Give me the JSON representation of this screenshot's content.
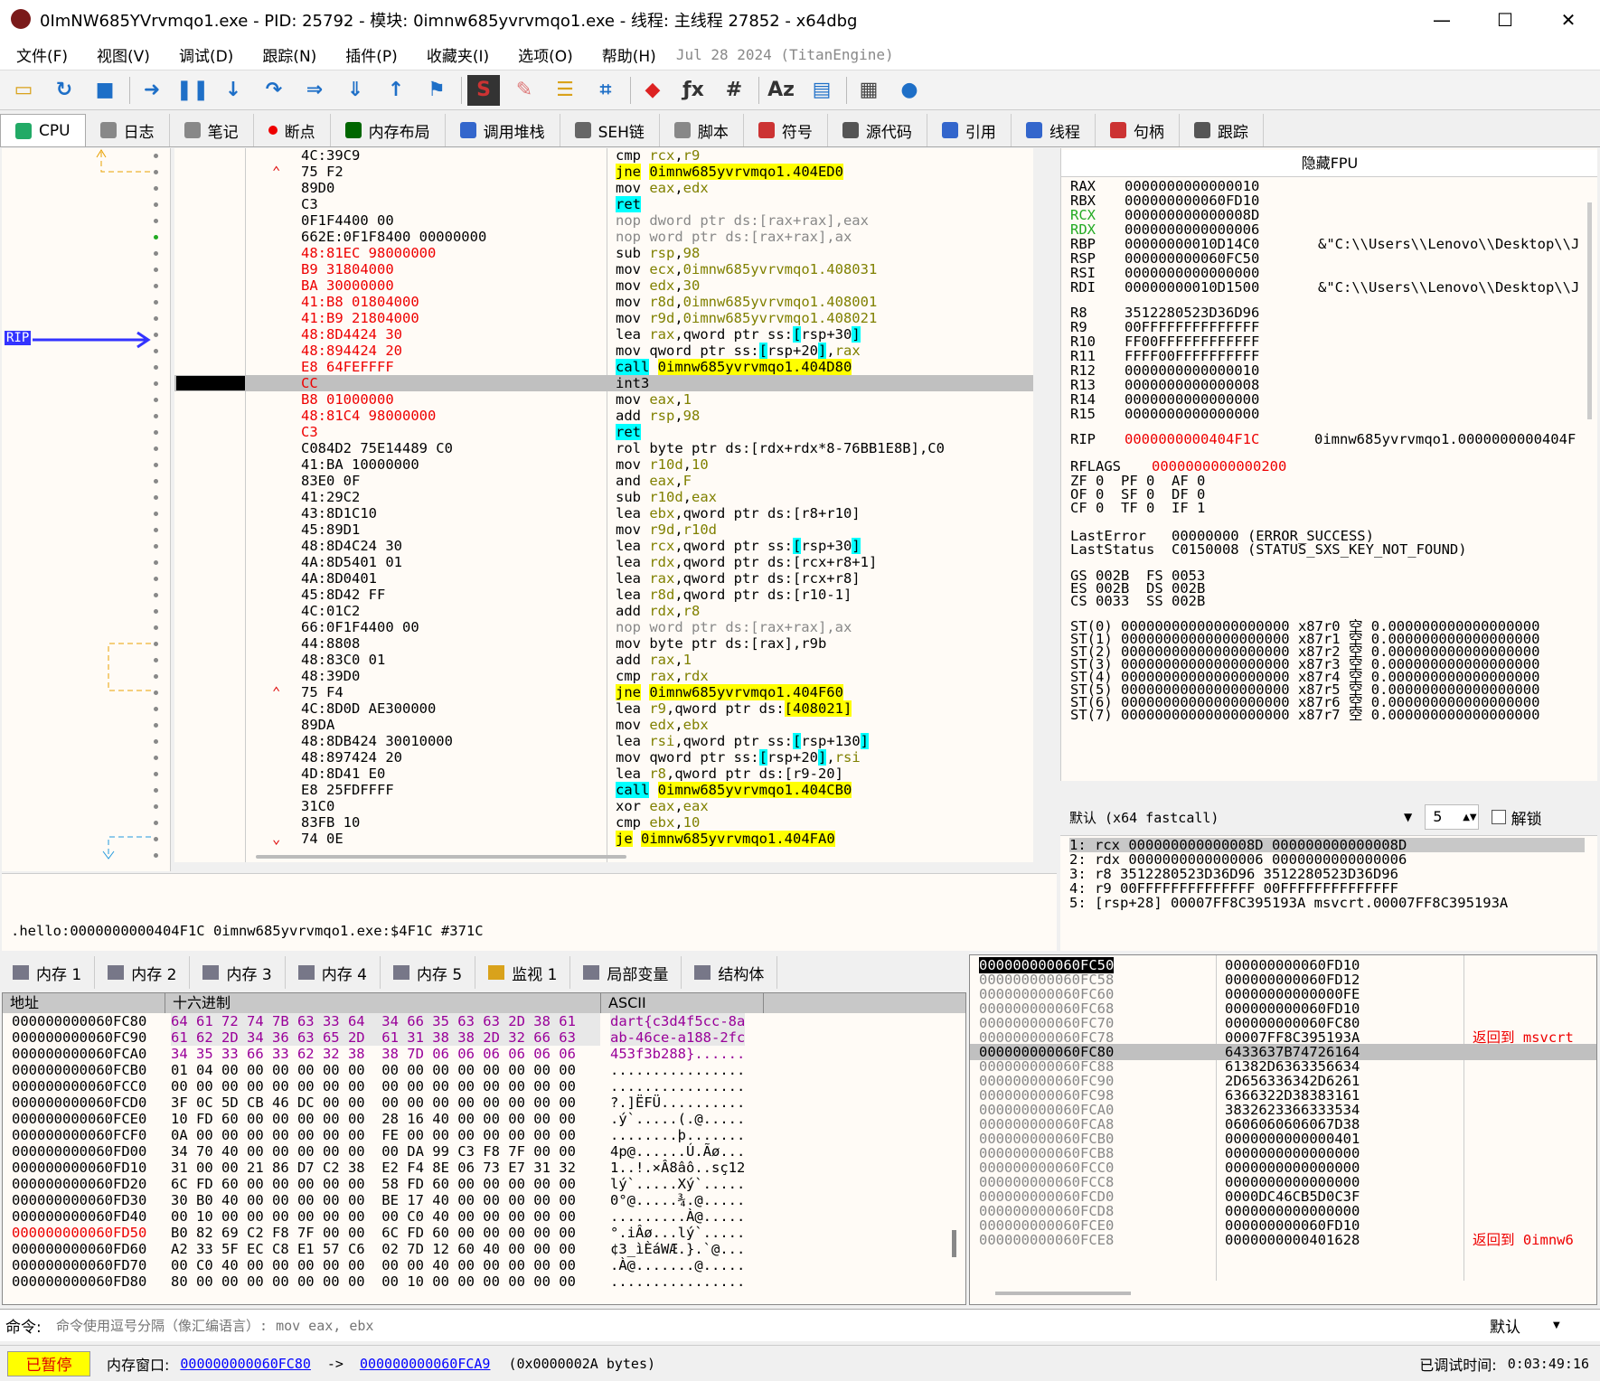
{
  "window": {
    "title": "0ImNW685YVrvmqo1.exe - PID: 25792 - 模块: 0imnw685yvrvmqo1.exe - 线程: 主线程 27852 - x64dbg",
    "minimize": "—",
    "maximize": "☐",
    "close": "✕"
  },
  "menu": [
    "文件(F)",
    "视图(V)",
    "调试(D)",
    "跟踪(N)",
    "插件(P)",
    "收藏夹(I)",
    "选项(O)",
    "帮助(H)"
  ],
  "menu_date": "Jul 28 2024 (TitanEngine)",
  "toolbar": [
    "open-icon",
    "restart-icon",
    "stop-icon",
    "run-icon",
    "pause-icon",
    "step-into-icon",
    "step-over-icon",
    "trace-into-icon",
    "trace-over-icon",
    "execute-till-return-icon",
    "run-to-user-code-icon",
    "script-icon",
    "patch-icon",
    "comment-icon",
    "label-icon",
    "bookmark-icon",
    "function-icon",
    "hash-icon",
    "font-icon",
    "memory-map-icon",
    "calculator-icon",
    "globe-icon"
  ],
  "tabs": [
    {
      "label": "CPU",
      "color": "#2a6"
    },
    {
      "label": "日志",
      "color": "#888"
    },
    {
      "label": "笔记",
      "color": "#888"
    },
    {
      "label": "断点",
      "color": "#e00"
    },
    {
      "label": "内存布局",
      "color": "#060"
    },
    {
      "label": "调用堆栈",
      "color": "#36c"
    },
    {
      "label": "SEH链",
      "color": "#666"
    },
    {
      "label": "脚本",
      "color": "#888"
    },
    {
      "label": "符号",
      "color": "#c33"
    },
    {
      "label": "源代码",
      "color": "#555"
    },
    {
      "label": "引用",
      "color": "#36c"
    },
    {
      "label": "线程",
      "color": "#36c"
    },
    {
      "label": "句柄",
      "color": "#c33"
    },
    {
      "label": "跟踪",
      "color": "#555"
    }
  ],
  "gutter": {
    "rip_label": "RIP"
  },
  "disasm": [
    {
      "b": "4C:39C9",
      "i": [
        [
          "cmp ",
          ""
        ],
        [
          "rcx",
          "reg"
        ],
        [
          ",",
          ""
        ],
        [
          "r9",
          "reg"
        ]
      ]
    },
    {
      "ar": "^",
      "b": "75 F2",
      "i": [
        [
          "jne",
          ""
        ],
        [
          " ",
          ""
        ],
        [
          "0imnw685yvrvmqo1.404ED0",
          "hl"
        ]
      ],
      "jhl": true
    },
    {
      "b": "89D0",
      "i": [
        [
          "mov ",
          ""
        ],
        [
          "eax",
          "reg"
        ],
        [
          ",",
          ""
        ],
        [
          "edx",
          "reg"
        ]
      ]
    },
    {
      "b": "C3",
      "i": [
        [
          "ret",
          "sq"
        ]
      ]
    },
    {
      "b": "0F1F4400 00",
      "i": [
        [
          "nop dword ptr ds:[rax+rax],eax",
          "gray"
        ]
      ]
    },
    {
      "b": "662E:0F1F8400 00000000",
      "i": [
        [
          "nop word ptr ds:[rax+rax],ax",
          "gray"
        ]
      ]
    },
    {
      "b": "48:81EC 98000000",
      "red": true,
      "i": [
        [
          "sub ",
          ""
        ],
        [
          "rsp",
          "reg"
        ],
        [
          ",",
          ""
        ],
        [
          "98",
          "num"
        ]
      ]
    },
    {
      "b": "B9 31804000",
      "red": true,
      "i": [
        [
          "mov ",
          ""
        ],
        [
          "ecx",
          "reg"
        ],
        [
          ",",
          ""
        ],
        [
          "0imnw685yvrvmqo1.408031",
          "num"
        ]
      ]
    },
    {
      "b": "BA 30000000",
      "red": true,
      "i": [
        [
          "mov ",
          ""
        ],
        [
          "edx",
          "reg"
        ],
        [
          ",",
          ""
        ],
        [
          "30",
          "num"
        ]
      ]
    },
    {
      "b": "41:B8 01804000",
      "red": true,
      "i": [
        [
          "mov ",
          ""
        ],
        [
          "r8d",
          "reg"
        ],
        [
          ",",
          ""
        ],
        [
          "0imnw685yvrvmqo1.408001",
          "num"
        ]
      ]
    },
    {
      "b": "41:B9 21804000",
      "red": true,
      "i": [
        [
          "mov ",
          ""
        ],
        [
          "r9d",
          "reg"
        ],
        [
          ",",
          ""
        ],
        [
          "0imnw685yvrvmqo1.408021",
          "num"
        ]
      ]
    },
    {
      "b": "48:8D4424 30",
      "red": true,
      "i": [
        [
          "lea ",
          ""
        ],
        [
          "rax",
          "reg"
        ],
        [
          ",qword ptr ",
          ""
        ],
        [
          "ss:",
          ""
        ],
        [
          "[",
          "sq"
        ],
        [
          "rsp+30",
          ""
        ],
        [
          "]",
          "sq"
        ]
      ]
    },
    {
      "b": "48:894424 20",
      "red": true,
      "i": [
        [
          "mov ",
          ""
        ],
        [
          "qword ptr ss:",
          ""
        ],
        [
          "[",
          "sq"
        ],
        [
          "rsp+20",
          ""
        ],
        [
          "]",
          "sq"
        ],
        [
          ",",
          ""
        ],
        [
          "rax",
          "reg"
        ]
      ]
    },
    {
      "b": "E8 64FEFFFF",
      "red": true,
      "i": [
        [
          "call",
          "sq"
        ],
        [
          " ",
          ""
        ],
        [
          "0imnw685yvrvmqo1.404D80",
          "hl"
        ]
      ]
    },
    {
      "b": "CC",
      "red": true,
      "sel": true,
      "i": [
        [
          "int3",
          ""
        ]
      ]
    },
    {
      "b": "B8 01000000",
      "red": true,
      "i": [
        [
          "mov ",
          ""
        ],
        [
          "eax",
          "reg"
        ],
        [
          ",",
          ""
        ],
        [
          "1",
          "num"
        ]
      ]
    },
    {
      "b": "48:81C4 98000000",
      "red": true,
      "i": [
        [
          "add ",
          ""
        ],
        [
          "rsp",
          "reg"
        ],
        [
          ",",
          ""
        ],
        [
          "98",
          "num"
        ]
      ]
    },
    {
      "b": "C3",
      "red": true,
      "i": [
        [
          "ret",
          "sq"
        ]
      ]
    },
    {
      "b": "C084D2 75E14489 C0",
      "i": [
        [
          "rol byte ptr ds:[rdx+rdx*8-76BB1E8B],C0",
          ""
        ]
      ]
    },
    {
      "b": "41:BA 10000000",
      "i": [
        [
          "mov ",
          ""
        ],
        [
          "r10d",
          "reg"
        ],
        [
          ",",
          ""
        ],
        [
          "10",
          "num"
        ]
      ]
    },
    {
      "b": "83E0 0F",
      "i": [
        [
          "and ",
          ""
        ],
        [
          "eax",
          "reg"
        ],
        [
          ",",
          ""
        ],
        [
          "F",
          "num"
        ]
      ]
    },
    {
      "b": "41:29C2",
      "i": [
        [
          "sub ",
          ""
        ],
        [
          "r10d",
          "reg"
        ],
        [
          ",",
          ""
        ],
        [
          "eax",
          "reg"
        ]
      ]
    },
    {
      "b": "43:8D1C10",
      "i": [
        [
          "lea ",
          ""
        ],
        [
          "ebx",
          "reg"
        ],
        [
          ",qword ptr ds:[r8+r10]",
          ""
        ]
      ]
    },
    {
      "b": "45:89D1",
      "i": [
        [
          "mov ",
          ""
        ],
        [
          "r9d",
          "reg"
        ],
        [
          ",",
          ""
        ],
        [
          "r10d",
          "reg"
        ]
      ]
    },
    {
      "b": "48:8D4C24 30",
      "i": [
        [
          "lea ",
          ""
        ],
        [
          "rcx",
          "reg"
        ],
        [
          ",qword ptr ss:",
          ""
        ],
        [
          "[",
          "sq"
        ],
        [
          "rsp+30",
          ""
        ],
        [
          "]",
          "sq"
        ]
      ]
    },
    {
      "b": "4A:8D5401 01",
      "i": [
        [
          "lea ",
          ""
        ],
        [
          "rdx",
          "reg"
        ],
        [
          ",qword ptr ds:[rcx+r8+1]",
          ""
        ]
      ]
    },
    {
      "b": "4A:8D0401",
      "i": [
        [
          "lea ",
          ""
        ],
        [
          "rax",
          "reg"
        ],
        [
          ",qword ptr ds:[rcx+r8]",
          ""
        ]
      ]
    },
    {
      "b": "45:8D42 FF",
      "i": [
        [
          "lea ",
          ""
        ],
        [
          "r8d",
          "reg"
        ],
        [
          ",qword ptr ds:[r10-1]",
          ""
        ]
      ]
    },
    {
      "b": "4C:01C2",
      "i": [
        [
          "add ",
          ""
        ],
        [
          "rdx",
          "reg"
        ],
        [
          ",",
          ""
        ],
        [
          "r8",
          "reg"
        ]
      ]
    },
    {
      "b": "66:0F1F4400 00",
      "i": [
        [
          "nop word ptr ds:[rax+rax],ax",
          "gray"
        ]
      ]
    },
    {
      "b": "44:8808",
      "i": [
        [
          "mov byte ptr ds:[rax],r9b",
          ""
        ]
      ]
    },
    {
      "b": "48:83C0 01",
      "i": [
        [
          "add ",
          ""
        ],
        [
          "rax",
          "reg"
        ],
        [
          ",",
          ""
        ],
        [
          "1",
          "num"
        ]
      ]
    },
    {
      "b": "48:39D0",
      "i": [
        [
          "cmp ",
          ""
        ],
        [
          "rax",
          "reg"
        ],
        [
          ",",
          ""
        ],
        [
          "rdx",
          "reg"
        ]
      ]
    },
    {
      "ar": "^",
      "b": "75 F4",
      "i": [
        [
          "jne",
          ""
        ],
        [
          " ",
          ""
        ],
        [
          "0imnw685yvrvmqo1.404F60",
          "hl"
        ]
      ],
      "jhl": true
    },
    {
      "b": "4C:8D0D AE300000",
      "i": [
        [
          "lea ",
          ""
        ],
        [
          "r9",
          "reg"
        ],
        [
          ",qword ptr ds:",
          ""
        ],
        [
          "[408021]",
          "hl"
        ]
      ]
    },
    {
      "b": "89DA",
      "i": [
        [
          "mov ",
          ""
        ],
        [
          "edx",
          "reg"
        ],
        [
          ",",
          ""
        ],
        [
          "ebx",
          "reg"
        ]
      ]
    },
    {
      "b": "48:8DB424 30010000",
      "i": [
        [
          "lea ",
          ""
        ],
        [
          "rsi",
          "reg"
        ],
        [
          ",qword ptr ss:",
          ""
        ],
        [
          "[",
          "sq"
        ],
        [
          "rsp+130",
          ""
        ],
        [
          "]",
          "sq"
        ]
      ]
    },
    {
      "b": "48:897424 20",
      "i": [
        [
          "mov ",
          ""
        ],
        [
          "qword ptr ss:",
          ""
        ],
        [
          "[",
          "sq"
        ],
        [
          "rsp+20",
          ""
        ],
        [
          "]",
          "sq"
        ],
        [
          ",",
          ""
        ],
        [
          "rsi",
          "reg"
        ]
      ]
    },
    {
      "b": "4D:8D41 E0",
      "i": [
        [
          "lea ",
          ""
        ],
        [
          "r8",
          "reg"
        ],
        [
          ",qword ptr ds:[r9-20]",
          ""
        ]
      ]
    },
    {
      "b": "E8 25FDFFFF",
      "i": [
        [
          "call",
          "sq"
        ],
        [
          " ",
          ""
        ],
        [
          "0imnw685yvrvmqo1.404CB0",
          "hl"
        ]
      ]
    },
    {
      "b": "31C0",
      "i": [
        [
          "xor ",
          ""
        ],
        [
          "eax",
          "reg"
        ],
        [
          ",",
          ""
        ],
        [
          "eax",
          "reg"
        ]
      ]
    },
    {
      "b": "83FB 10",
      "i": [
        [
          "cmp ",
          ""
        ],
        [
          "ebx",
          "reg"
        ],
        [
          ",",
          ""
        ],
        [
          "10",
          "num"
        ]
      ]
    },
    {
      "ar": "v",
      "b": "74 0E",
      "i": [
        [
          "je",
          ""
        ],
        [
          " ",
          ""
        ],
        [
          "0imnw685yvrvmqo1.404FA0",
          "hl"
        ]
      ],
      "jhl": true
    }
  ],
  "registers": {
    "header": "隐藏FPU",
    "gp": [
      [
        "RAX",
        "0000000000000010",
        ""
      ],
      [
        "RBX",
        "000000000060FD10",
        ""
      ],
      [
        "RCX",
        "000000000000008D",
        ""
      ],
      [
        "RDX",
        "0000000000000006",
        ""
      ],
      [
        "RBP",
        "00000000010D14C0",
        "&\"C:\\\\Users\\\\Lenovo\\\\Desktop\\\\J"
      ],
      [
        "RSP",
        "000000000060FC50",
        ""
      ],
      [
        "RSI",
        "0000000000000000",
        ""
      ],
      [
        "RDI",
        "00000000010D1500",
        "&\"C:\\\\Users\\\\Lenovo\\\\Desktop\\\\J"
      ]
    ],
    "ext": [
      [
        "R8",
        "3512280523D36D96"
      ],
      [
        "R9",
        "00FFFFFFFFFFFFFF"
      ],
      [
        "R10",
        "FF00FFFFFFFFFFFF"
      ],
      [
        "R11",
        "FFFF00FFFFFFFFFF"
      ],
      [
        "R12",
        "0000000000000010"
      ],
      [
        "R13",
        "0000000000000008"
      ],
      [
        "R14",
        "0000000000000000"
      ],
      [
        "R15",
        "0000000000000000"
      ]
    ],
    "rip": [
      "RIP",
      "0000000000404F1C",
      "0imnw685yvrvmqo1.0000000000404F"
    ],
    "rflags": [
      "RFLAGS",
      "0000000000000200"
    ],
    "flags": [
      "ZF 0  PF 0  AF 0",
      "OF 0  SF 0  DF 0",
      "CF 0  TF 0  IF 1"
    ],
    "lasterror": "LastError   00000000 (ERROR_SUCCESS)",
    "laststatus": "LastStatus  C0150008 (STATUS_SXS_KEY_NOT_FOUND)",
    "seg": [
      "GS 002B  FS 0053",
      "ES 002B  DS 002B",
      "CS 0033  SS 002B"
    ],
    "st": [
      "ST(0) 00000000000000000000 x87r0 空 0.000000000000000000",
      "ST(1) 00000000000000000000 x87r1 空 0.000000000000000000",
      "ST(2) 00000000000000000000 x87r2 空 0.000000000000000000",
      "ST(3) 00000000000000000000 x87r3 空 0.000000000000000000",
      "ST(4) 00000000000000000000 x87r4 空 0.000000000000000000",
      "ST(5) 00000000000000000000 x87r5 空 0.000000000000000000",
      "ST(6) 00000000000000000000 x87r6 空 0.000000000000000000",
      "ST(7) 00000000000000000000 x87r7 空 0.000000000000000000"
    ]
  },
  "callconv": {
    "value": "默认 (x64 fastcall)",
    "count": "5",
    "unlock": "解锁"
  },
  "stackargs": [
    "1: rcx 000000000000008D 000000000000008D",
    "2: rdx 0000000000000006 0000000000000006",
    "3: r8 3512280523D36D96 3512280523D36D96",
    "4: r9 00FFFFFFFFFFFFFF 00FFFFFFFFFFFFFF",
    "5: [rsp+28] 00007FF8C395193A msvcrt.00007FF8C395193A"
  ],
  "info": ".hello:0000000000404F1C 0imnw685yvrvmqo1.exe:$4F1C #371C",
  "memtabs": [
    "内存 1",
    "内存 2",
    "内存 3",
    "内存 4",
    "内存 5",
    "监视 1",
    "局部变量",
    "结构体"
  ],
  "dump": {
    "headers": [
      "地址",
      "十六进制",
      "ASCII"
    ],
    "rows": [
      [
        "000000000060FC80",
        "64 61 72 74 7B 63 33 64  34 66 35 63 63 2D 38 61",
        "dart{c3d4f5cc-8a"
      ],
      [
        "000000000060FC90",
        "61 62 2D 34 36 63 65 2D  61 31 38 38 2D 32 66 63",
        "ab-46ce-a188-2fc"
      ],
      [
        "000000000060FCA0",
        "34 35 33 66 33 62 32 38  38 7D 06 06 06 06 06 06",
        "453f3b288}......"
      ],
      [
        "000000000060FCB0",
        "01 04 00 00 00 00 00 00  00 00 00 00 00 00 00 00",
        "................"
      ],
      [
        "000000000060FCC0",
        "00 00 00 00 00 00 00 00  00 00 00 00 00 00 00 00",
        "................"
      ],
      [
        "000000000060FCD0",
        "3F 0C 5D CB 46 DC 00 00  00 00 00 00 00 00 00 00",
        "?.]ËFÜ.........."
      ],
      [
        "000000000060FCE0",
        "10 FD 60 00 00 00 00 00  28 16 40 00 00 00 00 00",
        ".ý`.....(.@....."
      ],
      [
        "000000000060FCF0",
        "0A 00 00 00 00 00 00 00  FE 00 00 00 00 00 00 00",
        "........þ......."
      ],
      [
        "000000000060FD00",
        "34 70 40 00 00 00 00 00  00 DA 99 C3 F8 7F 00 00",
        "4p@......Ú.Ãø..."
      ],
      [
        "000000000060FD10",
        "31 00 00 21 86 D7 C2 38  E2 F4 8E 06 73 E7 31 32",
        "1..!.×Â8âô..sç12"
      ],
      [
        "000000000060FD20",
        "6C FD 60 00 00 00 00 00  58 FD 60 00 00 00 00 00",
        "lý`.....Xý`....."
      ],
      [
        "000000000060FD30",
        "30 B0 40 00 00 00 00 00  BE 17 40 00 00 00 00 00",
        "0°@.....¾.@....."
      ],
      [
        "000000000060FD40",
        "00 10 00 00 00 00 00 00  00 C0 40 00 00 00 00 00",
        ".........À@....."
      ],
      [
        "000000000060FD50",
        "B0 82 69 C2 F8 7F 00 00  6C FD 60 00 00 00 00 00",
        "°.iÂø...lý`....."
      ],
      [
        "000000000060FD60",
        "A2 33 5F EC C8 E1 57 C6  02 7D 12 60 40 00 00 00",
        "¢3_ìÈáWÆ.}.`@..."
      ],
      [
        "000000000060FD70",
        "00 C0 40 00 00 00 00 00  00 00 40 00 00 00 00 00",
        ".À@.......@....."
      ],
      [
        "000000000060FD80",
        "80 00 00 00 00 00 00 00  00 10 00 00 00 00 00 00",
        "................"
      ]
    ]
  },
  "stack": [
    [
      "000000000060FC50",
      "000000000060FD10",
      ""
    ],
    [
      "000000000060FC58",
      "000000000060FD12",
      ""
    ],
    [
      "000000000060FC60",
      "00000000000000FE",
      ""
    ],
    [
      "000000000060FC68",
      "000000000060FD10",
      ""
    ],
    [
      "000000000060FC70",
      "000000000060FC80",
      ""
    ],
    [
      "000000000060FC78",
      "00007FF8C395193A",
      "返回到 msvcrt"
    ],
    [
      "000000000060FC80",
      "6433637B74726164",
      ""
    ],
    [
      "000000000060FC88",
      "61382D6363356634",
      ""
    ],
    [
      "000000000060FC90",
      "2D656336342D6261",
      ""
    ],
    [
      "000000000060FC98",
      "6366322D38383161",
      ""
    ],
    [
      "000000000060FCA0",
      "3832623366333534",
      ""
    ],
    [
      "000000000060FCA8",
      "0606060606067D38",
      ""
    ],
    [
      "000000000060FCB0",
      "0000000000000401",
      ""
    ],
    [
      "000000000060FCB8",
      "0000000000000000",
      ""
    ],
    [
      "000000000060FCC0",
      "0000000000000000",
      ""
    ],
    [
      "000000000060FCC8",
      "0000000000000000",
      ""
    ],
    [
      "000000000060FCD0",
      "0000DC46CB5D0C3F",
      ""
    ],
    [
      "000000000060FCD8",
      "0000000000000000",
      ""
    ],
    [
      "000000000060FCE0",
      "000000000060FD10",
      ""
    ],
    [
      "000000000060FCE8",
      "0000000000401628",
      "返回到 0imnw6"
    ]
  ],
  "command": {
    "label": "命令:",
    "placeholder": "命令使用逗号分隔（像汇编语言）: mov eax, ebx",
    "mode": "默认"
  },
  "status": {
    "state": "已暂停",
    "memwin_label": "内存窗口:",
    "from": "000000000060FC80",
    "arrow": "->",
    "to": "000000000060FCA9",
    "size": "(0x0000002A  bytes)",
    "time_label": "已调试时间:",
    "time": "0:03:49:16"
  }
}
